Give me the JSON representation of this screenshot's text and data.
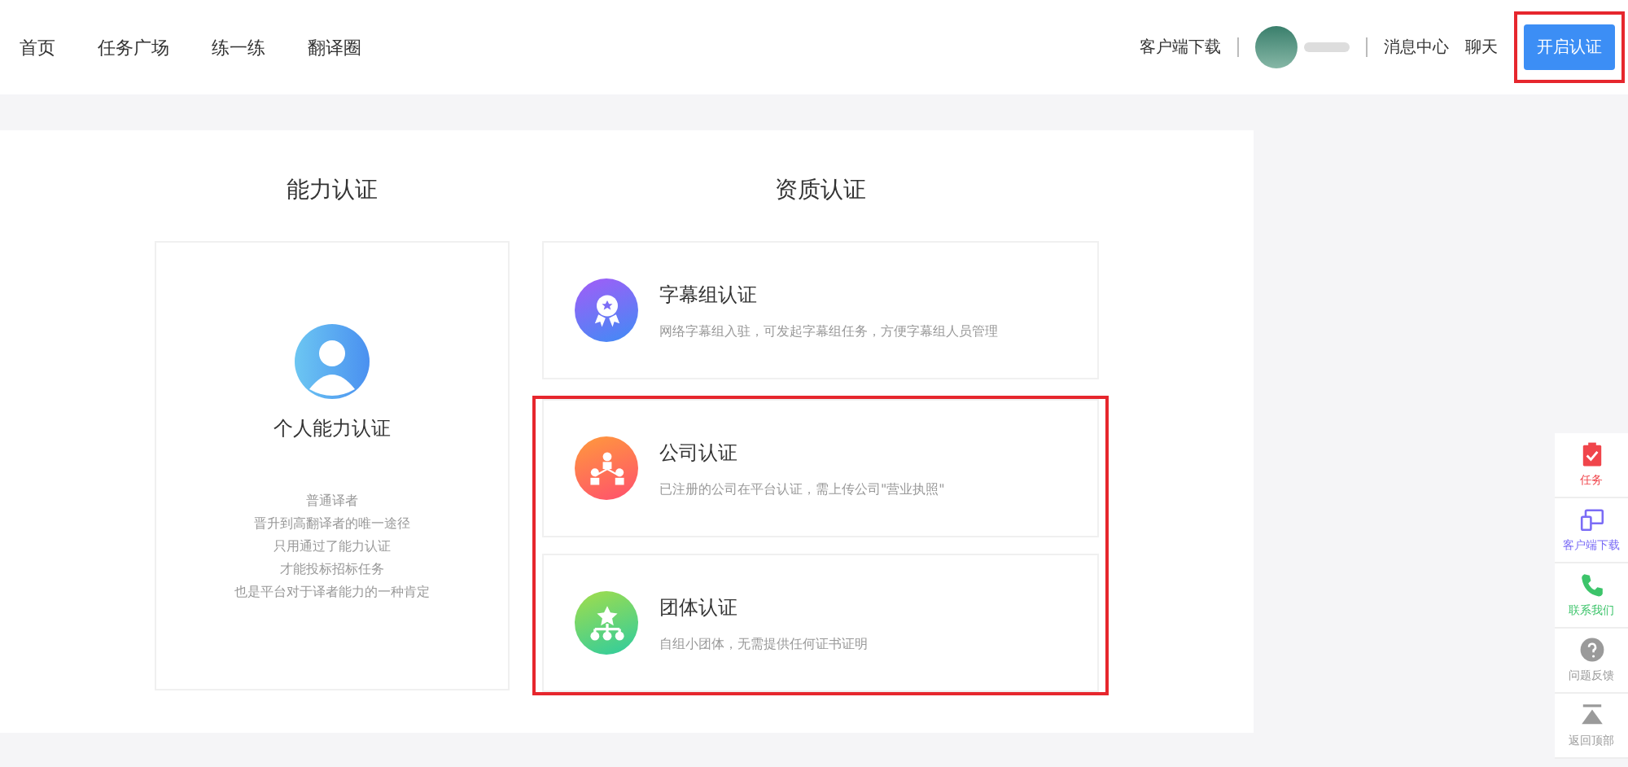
{
  "nav": {
    "links": [
      {
        "label": "首页"
      },
      {
        "label": "任务广场"
      },
      {
        "label": "练一练"
      },
      {
        "label": "翻译圈"
      }
    ],
    "download": "客户端下载",
    "messages": "消息中心",
    "chat": "聊天",
    "cta": {
      "label": "开启认证",
      "highlighted": true
    }
  },
  "ability": {
    "title": "能力认证",
    "card": {
      "title": "个人能力认证",
      "lines": [
        "普通译者",
        "晋升到高翻译者的唯一途径",
        "只用通过了能力认证",
        "才能投标招标任务",
        "也是平台对于译者能力的一种肯定"
      ]
    }
  },
  "qualification": {
    "title": "资质认证",
    "cards": [
      {
        "kind": "medal",
        "title": "字幕组认证",
        "desc": "网络字幕组入驻，可发起字幕组任务，方便字幕组人员管理"
      }
    ],
    "highlighted_group": {
      "highlighted": true,
      "cards": [
        {
          "kind": "company",
          "title": "公司认证",
          "desc": "已注册的公司在平台认证，需上传公司\"营业执照\""
        },
        {
          "kind": "team",
          "title": "团体认证",
          "desc": "自组小团体，无需提供任何证书证明"
        }
      ]
    }
  },
  "side_tools": [
    {
      "kind": "task",
      "label": "任务",
      "color": "#f0454b"
    },
    {
      "kind": "devices",
      "label": "客户端下载",
      "color": "#7b6cf6"
    },
    {
      "kind": "phone",
      "label": "联系我们",
      "color": "#3cc46a"
    },
    {
      "kind": "help",
      "label": "问题反馈",
      "color": "#9a9a9a"
    },
    {
      "kind": "top",
      "label": "返回顶部",
      "color": "#9a9a9a"
    }
  ]
}
